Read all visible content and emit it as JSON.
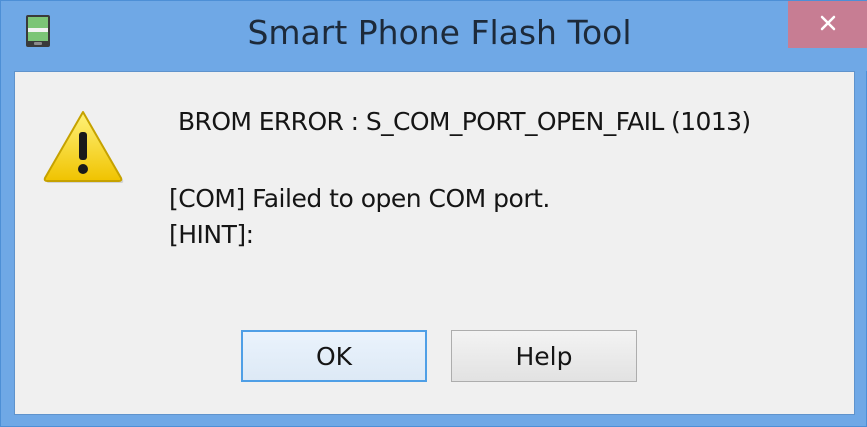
{
  "window": {
    "title": "Smart Phone Flash Tool",
    "app_icon": "android-phone-icon",
    "close_icon": "close-icon",
    "colors": {
      "frame": "#6fa8e6",
      "close_button": "#c77d93",
      "client_bg": "#f0f0f0",
      "default_button_border": "#4f9fe6"
    }
  },
  "dialog": {
    "icon": "warning-icon",
    "error_title": "BROM ERROR : S_COM_PORT_OPEN_FAIL (1013)",
    "message": "[COM] Failed to open COM port.",
    "hint": "[HINT]:"
  },
  "buttons": {
    "ok_label": "OK",
    "help_label": "Help"
  }
}
